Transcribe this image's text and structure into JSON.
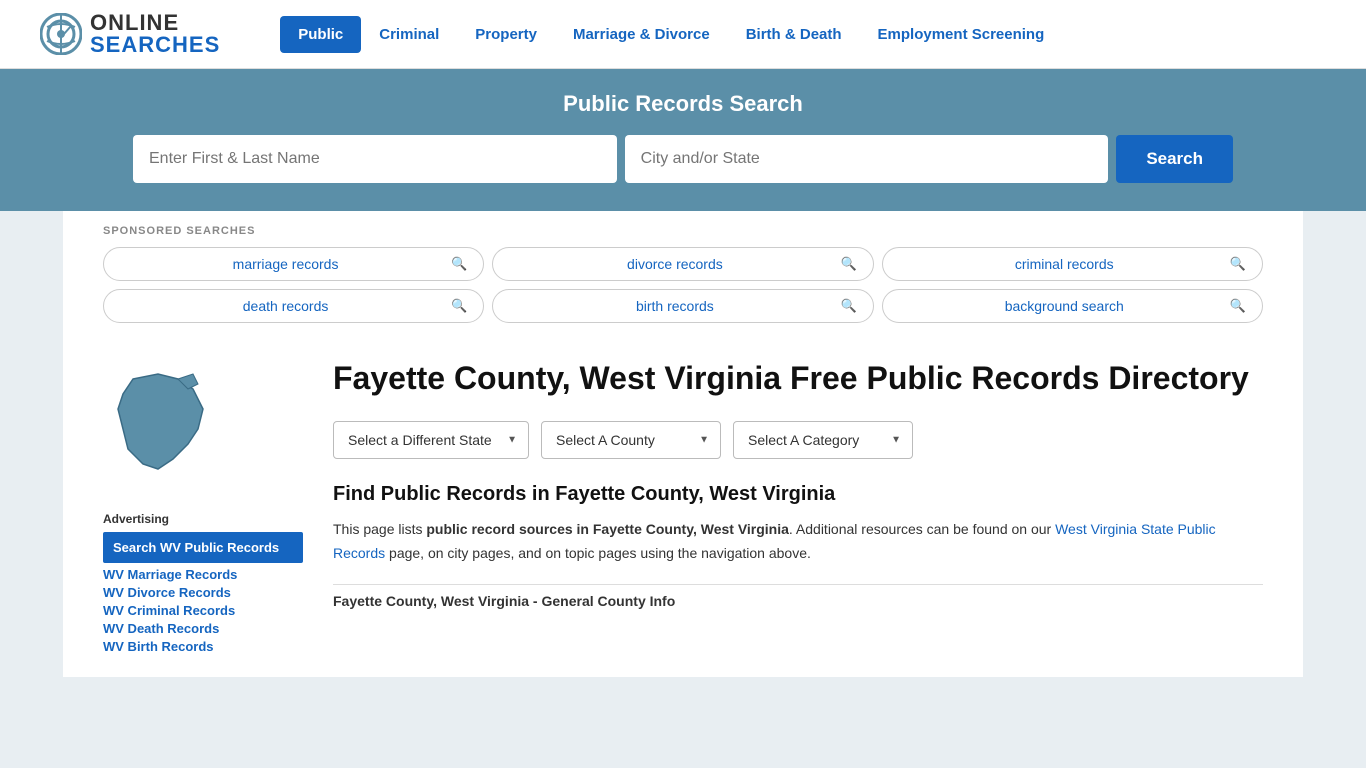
{
  "header": {
    "logo_online": "ONLINE",
    "logo_searches": "SEARCHES",
    "nav_items": [
      {
        "label": "Public",
        "active": true
      },
      {
        "label": "Criminal",
        "active": false
      },
      {
        "label": "Property",
        "active": false
      },
      {
        "label": "Marriage & Divorce",
        "active": false
      },
      {
        "label": "Birth & Death",
        "active": false
      },
      {
        "label": "Employment Screening",
        "active": false
      }
    ]
  },
  "banner": {
    "title": "Public Records Search",
    "name_placeholder": "Enter First & Last Name",
    "city_placeholder": "City and/or State",
    "search_button": "Search"
  },
  "sponsored": {
    "label": "SPONSORED SEARCHES",
    "tags": [
      {
        "label": "marriage records"
      },
      {
        "label": "divorce records"
      },
      {
        "label": "criminal records"
      },
      {
        "label": "death records"
      },
      {
        "label": "birth records"
      },
      {
        "label": "background search"
      }
    ]
  },
  "sidebar": {
    "advertising_label": "Advertising",
    "ad_item": "Search WV Public Records",
    "links": [
      "WV Marriage Records",
      "WV Divorce Records",
      "WV Criminal Records",
      "WV Death Records",
      "WV Birth Records"
    ]
  },
  "article": {
    "title": "Fayette County, West Virginia Free Public Records Directory",
    "dropdowns": {
      "state": "Select a Different State",
      "county": "Select A County",
      "category": "Select A Category"
    },
    "find_title": "Find Public Records in Fayette County, West Virginia",
    "find_description_part1": "This page lists ",
    "find_description_bold1": "public record sources in Fayette County, West Virginia",
    "find_description_part2": ". Additional resources can be found on our ",
    "find_link": "West Virginia State Public Records",
    "find_description_part3": " page, on city pages, and on topic pages using the navigation above.",
    "general_info": "Fayette County, West Virginia - General County Info"
  }
}
